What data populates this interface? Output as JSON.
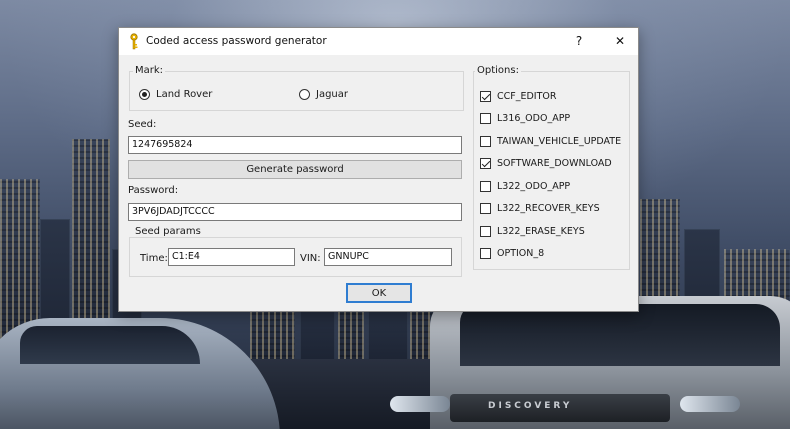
{
  "window": {
    "title": "Coded access password generator",
    "help_label": "?",
    "close_label": "✕"
  },
  "mark": {
    "group_label": "Mark:",
    "options": [
      {
        "label": "Land Rover",
        "selected": true
      },
      {
        "label": "Jaguar",
        "selected": false
      }
    ]
  },
  "seed": {
    "label": "Seed:",
    "value": "1247695824"
  },
  "generate_button": "Generate password",
  "password": {
    "label": "Password:",
    "value": "3PV6JDADJTCCCC"
  },
  "seed_params": {
    "group_label": "Seed params",
    "time_label": "Time:",
    "time_value": "C1:E4",
    "vin_label": "VIN:",
    "vin_value": "GNNUPC"
  },
  "ok_button": "OK",
  "options": {
    "group_label": "Options:",
    "items": [
      {
        "label": "CCF_EDITOR",
        "checked": true
      },
      {
        "label": "L316_ODO_APP",
        "checked": false
      },
      {
        "label": "TAIWAN_VEHICLE_UPDATE",
        "checked": false
      },
      {
        "label": "SOFTWARE_DOWNLOAD",
        "checked": true
      },
      {
        "label": "L322_ODO_APP",
        "checked": false
      },
      {
        "label": "L322_RECOVER_KEYS",
        "checked": false
      },
      {
        "label": "L322_ERASE_KEYS",
        "checked": false
      },
      {
        "label": "OPTION_8",
        "checked": false
      }
    ]
  },
  "background": {
    "vehicle_badge": "DISCOVERY"
  },
  "colors": {
    "dialog_bg": "#f0f0f0",
    "default_button_border": "#2f7dd1"
  }
}
